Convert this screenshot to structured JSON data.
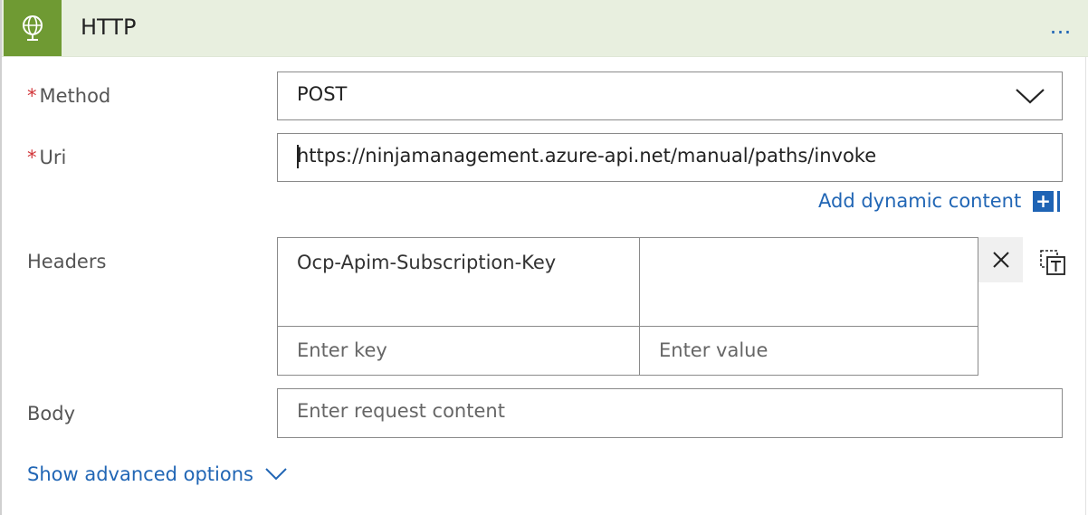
{
  "header": {
    "title": "HTTP",
    "icon": "globe-icon",
    "brand_color": "#6f9a33",
    "more_label": "…"
  },
  "method": {
    "label": "Method",
    "required_mark": "*",
    "value": "POST"
  },
  "uri": {
    "label": "Uri",
    "required_mark": "*",
    "value": "https://ninjamanagement.azure-api.net/manual/paths/invoke"
  },
  "dynamic_content": {
    "label": "Add dynamic content",
    "plus": "+"
  },
  "headers": {
    "label": "Headers",
    "rows": [
      {
        "key": "Ocp-Apim-Subscription-Key",
        "value": ""
      }
    ],
    "key_placeholder": "Enter key",
    "value_placeholder": "Enter value"
  },
  "body": {
    "label": "Body",
    "placeholder": "Enter request content"
  },
  "advanced": {
    "label": "Show advanced options"
  }
}
